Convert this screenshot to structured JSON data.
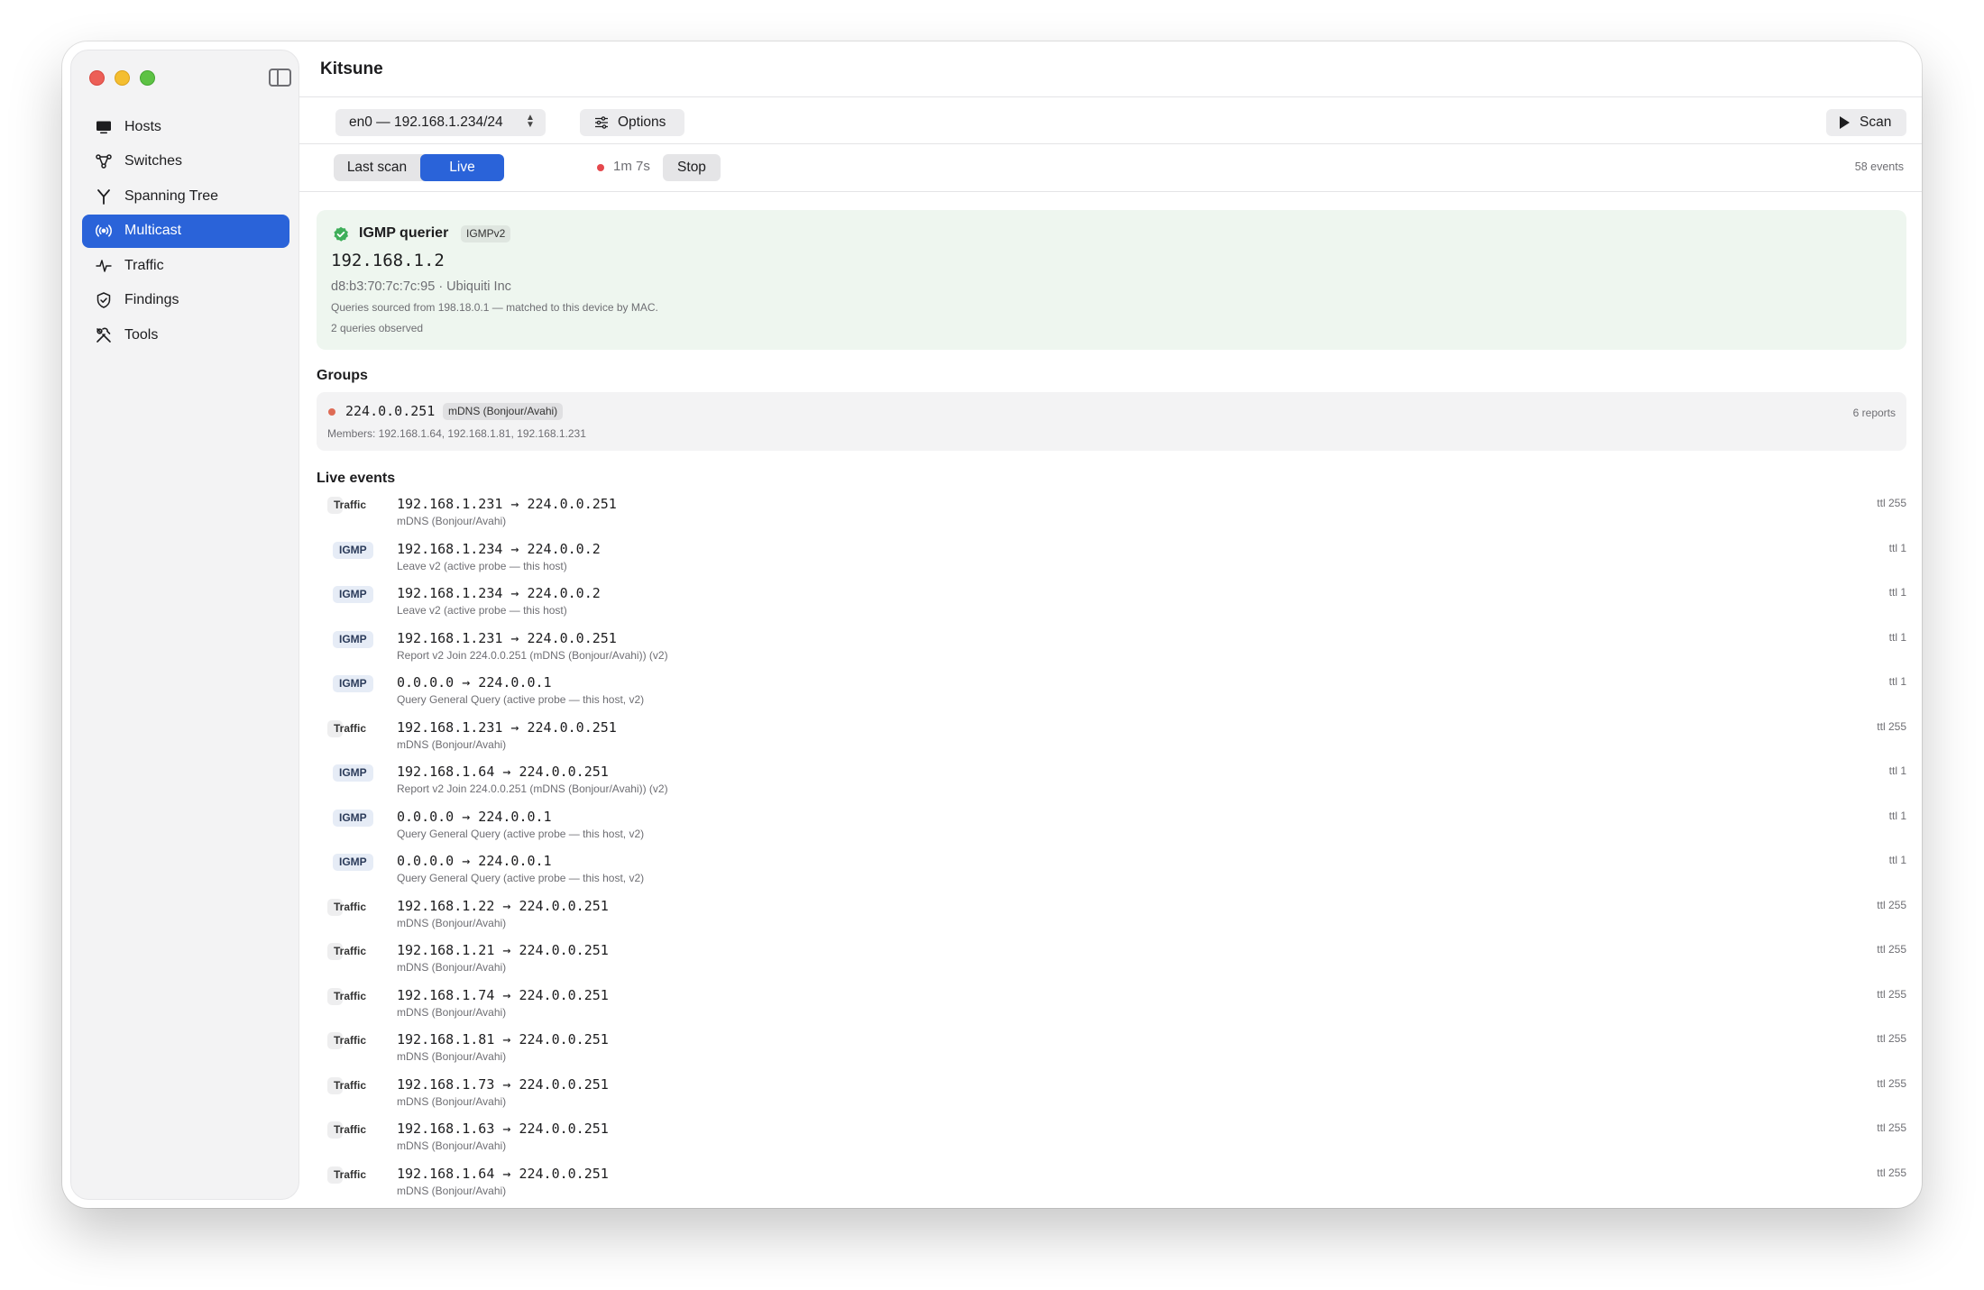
{
  "app": {
    "title": "Kitsune"
  },
  "sidebar": {
    "items": [
      {
        "label": "Hosts",
        "icon": "display-icon",
        "active": false
      },
      {
        "label": "Switches",
        "icon": "network-nodes-icon",
        "active": false
      },
      {
        "label": "Spanning Tree",
        "icon": "tree-branch-icon",
        "active": false
      },
      {
        "label": "Multicast",
        "icon": "broadcast-icon",
        "active": true
      },
      {
        "label": "Traffic",
        "icon": "waveform-icon",
        "active": false
      },
      {
        "label": "Findings",
        "icon": "shield-check-icon",
        "active": false
      },
      {
        "label": "Tools",
        "icon": "tools-icon",
        "active": false
      }
    ]
  },
  "toolbar": {
    "interface": "en0 — 192.168.1.234/24",
    "options_label": "Options",
    "scan_label": "Scan"
  },
  "mode": {
    "last_scan_label": "Last scan",
    "live_label": "Live",
    "elapsed": "1m 7s",
    "stop_label": "Stop",
    "event_count": "58 events"
  },
  "querier": {
    "title": "IGMP querier",
    "version": "IGMPv2",
    "ip": "192.168.1.2",
    "mac_vendor": "d8:b3:70:7c:7c:95 · Ubiquiti Inc",
    "note": "Queries sourced from 198.18.0.1 — matched to this device by MAC.",
    "count": "2 queries observed"
  },
  "groups": {
    "title": "Groups",
    "items": [
      {
        "address": "224.0.0.251",
        "service": "mDNS (Bonjour/Avahi)",
        "reports": "6 reports",
        "members": "Members: 192.168.1.64, 192.168.1.81, 192.168.1.231"
      }
    ]
  },
  "live_events": {
    "title": "Live events",
    "items": [
      {
        "kind": "Traffic",
        "flow": "192.168.1.231 → 224.0.0.251",
        "detail": "mDNS (Bonjour/Avahi)",
        "ttl": "ttl 255"
      },
      {
        "kind": "IGMP",
        "flow": "192.168.1.234 → 224.0.0.2",
        "detail": "Leave v2  (active probe — this host)",
        "ttl": "ttl 1"
      },
      {
        "kind": "IGMP",
        "flow": "192.168.1.234 → 224.0.0.2",
        "detail": "Leave v2  (active probe — this host)",
        "ttl": "ttl 1"
      },
      {
        "kind": "IGMP",
        "flow": "192.168.1.231 → 224.0.0.251",
        "detail": "Report v2  Join 224.0.0.251 (mDNS (Bonjour/Avahi)) (v2)",
        "ttl": "ttl 1"
      },
      {
        "kind": "IGMP",
        "flow": "0.0.0.0 → 224.0.0.1",
        "detail": "Query  General Query (active probe — this host, v2)",
        "ttl": "ttl 1"
      },
      {
        "kind": "Traffic",
        "flow": "192.168.1.231 → 224.0.0.251",
        "detail": "mDNS (Bonjour/Avahi)",
        "ttl": "ttl 255"
      },
      {
        "kind": "IGMP",
        "flow": "192.168.1.64 → 224.0.0.251",
        "detail": "Report v2  Join 224.0.0.251 (mDNS (Bonjour/Avahi)) (v2)",
        "ttl": "ttl 1"
      },
      {
        "kind": "IGMP",
        "flow": "0.0.0.0 → 224.0.0.1",
        "detail": "Query  General Query (active probe — this host, v2)",
        "ttl": "ttl 1"
      },
      {
        "kind": "IGMP",
        "flow": "0.0.0.0 → 224.0.0.1",
        "detail": "Query  General Query (active probe — this host, v2)",
        "ttl": "ttl 1"
      },
      {
        "kind": "Traffic",
        "flow": "192.168.1.22 → 224.0.0.251",
        "detail": "mDNS (Bonjour/Avahi)",
        "ttl": "ttl 255"
      },
      {
        "kind": "Traffic",
        "flow": "192.168.1.21 → 224.0.0.251",
        "detail": "mDNS (Bonjour/Avahi)",
        "ttl": "ttl 255"
      },
      {
        "kind": "Traffic",
        "flow": "192.168.1.74 → 224.0.0.251",
        "detail": "mDNS (Bonjour/Avahi)",
        "ttl": "ttl 255"
      },
      {
        "kind": "Traffic",
        "flow": "192.168.1.81 → 224.0.0.251",
        "detail": "mDNS (Bonjour/Avahi)",
        "ttl": "ttl 255"
      },
      {
        "kind": "Traffic",
        "flow": "192.168.1.73 → 224.0.0.251",
        "detail": "mDNS (Bonjour/Avahi)",
        "ttl": "ttl 255"
      },
      {
        "kind": "Traffic",
        "flow": "192.168.1.63 → 224.0.0.251",
        "detail": "mDNS (Bonjour/Avahi)",
        "ttl": "ttl 255"
      },
      {
        "kind": "Traffic",
        "flow": "192.168.1.64 → 224.0.0.251",
        "detail": "mDNS (Bonjour/Avahi)",
        "ttl": "ttl 255"
      }
    ]
  },
  "colors": {
    "accent": "#2a63d9",
    "live_dot": "#e5484d",
    "group_dot": "#de6b55",
    "querier_bg": "#eef6ef",
    "querier_check": "#3fae5a"
  }
}
